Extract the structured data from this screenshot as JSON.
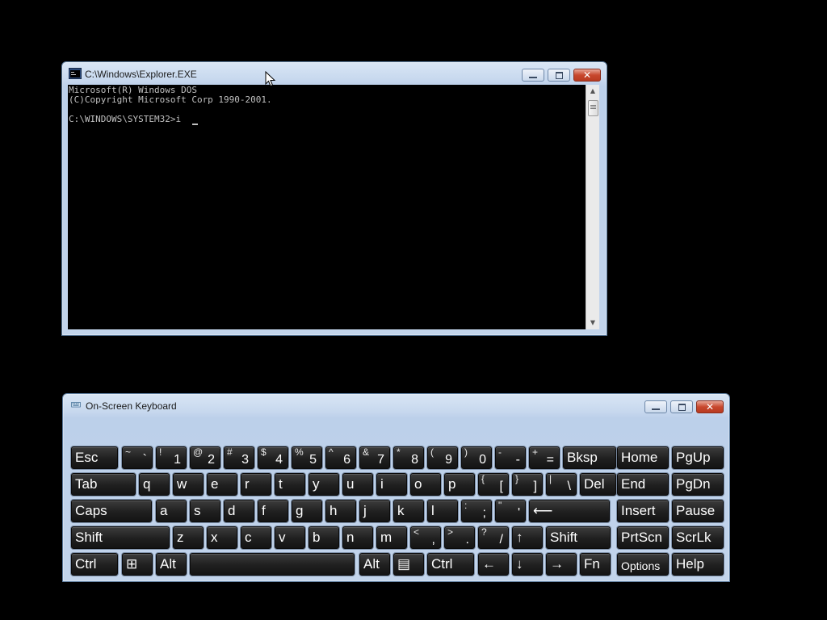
{
  "console_window": {
    "title": "C:\\Windows\\Explorer.EXE",
    "lines": [
      "Microsoft(R) Windows DOS",
      "(C)Copyright Microsoft Corp 1990-2001.",
      "",
      "C:\\WINDOWS\\SYSTEM32>i"
    ],
    "close_glyph": "✕"
  },
  "keyboard_window": {
    "title": "On-Screen Keyboard",
    "close_glyph": "✕",
    "rows": [
      [
        {
          "label": "Esc"
        },
        {
          "top": "~",
          "main": "`"
        },
        {
          "top": "!",
          "main": "1"
        },
        {
          "top": "@",
          "main": "2"
        },
        {
          "top": "#",
          "main": "3"
        },
        {
          "top": "$",
          "main": "4"
        },
        {
          "top": "%",
          "main": "5"
        },
        {
          "top": "^",
          "main": "6"
        },
        {
          "top": "&",
          "main": "7"
        },
        {
          "top": "*",
          "main": "8"
        },
        {
          "top": "(",
          "main": "9"
        },
        {
          "top": ")",
          "main": "0"
        },
        {
          "top": "-",
          "main": "-"
        },
        {
          "top": "+",
          "main": "="
        },
        {
          "label": "Bksp"
        },
        {
          "label": "Home"
        },
        {
          "label": "PgUp"
        }
      ],
      [
        {
          "label": "Tab"
        },
        {
          "label": "q"
        },
        {
          "label": "w"
        },
        {
          "label": "e"
        },
        {
          "label": "r"
        },
        {
          "label": "t"
        },
        {
          "label": "y"
        },
        {
          "label": "u"
        },
        {
          "label": "i"
        },
        {
          "label": "o"
        },
        {
          "label": "p"
        },
        {
          "top": "{",
          "main": "["
        },
        {
          "top": "}",
          "main": "]"
        },
        {
          "top": "|",
          "main": "\\"
        },
        {
          "label": "Del"
        },
        {
          "label": "End"
        },
        {
          "label": "PgDn"
        }
      ],
      [
        {
          "label": "Caps"
        },
        {
          "label": "a"
        },
        {
          "label": "s"
        },
        {
          "label": "d"
        },
        {
          "label": "f"
        },
        {
          "label": "g"
        },
        {
          "label": "h"
        },
        {
          "label": "j"
        },
        {
          "label": "k"
        },
        {
          "label": "l"
        },
        {
          "top": ":",
          "main": ";"
        },
        {
          "top": "\"",
          "main": "'"
        },
        {
          "label": "⟵"
        },
        {
          "label": "Insert"
        },
        {
          "label": "Pause"
        }
      ],
      [
        {
          "label": "Shift"
        },
        {
          "label": "z"
        },
        {
          "label": "x"
        },
        {
          "label": "c"
        },
        {
          "label": "v"
        },
        {
          "label": "b"
        },
        {
          "label": "n"
        },
        {
          "label": "m"
        },
        {
          "top": "<",
          "main": ","
        },
        {
          "top": ">",
          "main": "."
        },
        {
          "top": "?",
          "main": "/"
        },
        {
          "label": "↑"
        },
        {
          "label": "Shift"
        },
        {
          "label": "PrtScn"
        },
        {
          "label": "ScrLk"
        }
      ],
      [
        {
          "label": "Ctrl"
        },
        {
          "label": "⊞"
        },
        {
          "label": "Alt"
        },
        {
          "label": ""
        },
        {
          "label": "Alt"
        },
        {
          "label": "▤"
        },
        {
          "label": "Ctrl"
        },
        {
          "label": "←"
        },
        {
          "label": "↓"
        },
        {
          "label": "→"
        },
        {
          "label": "Fn"
        },
        {
          "label": "Options"
        },
        {
          "label": "Help"
        }
      ]
    ]
  }
}
